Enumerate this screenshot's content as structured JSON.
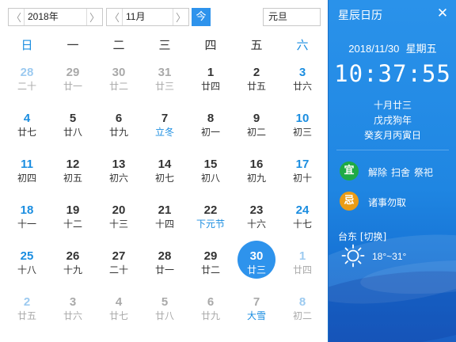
{
  "toolbar": {
    "year": "2018年",
    "month": "11月",
    "today_label": "今",
    "festival": "元旦",
    "prev_glyph": "〈",
    "next_glyph": "〉"
  },
  "weekdays": [
    "日",
    "一",
    "二",
    "三",
    "四",
    "五",
    "六"
  ],
  "days": [
    {
      "n": "28",
      "l": "二十",
      "other": true
    },
    {
      "n": "29",
      "l": "廿一",
      "other": true
    },
    {
      "n": "30",
      "l": "廿二",
      "other": true
    },
    {
      "n": "31",
      "l": "廿三",
      "other": true
    },
    {
      "n": "1",
      "l": "廿四"
    },
    {
      "n": "2",
      "l": "廿五"
    },
    {
      "n": "3",
      "l": "廿六"
    },
    {
      "n": "4",
      "l": "廿七"
    },
    {
      "n": "5",
      "l": "廿八"
    },
    {
      "n": "6",
      "l": "廿九"
    },
    {
      "n": "7",
      "l": "立冬",
      "term": true
    },
    {
      "n": "8",
      "l": "初一"
    },
    {
      "n": "9",
      "l": "初二"
    },
    {
      "n": "10",
      "l": "初三"
    },
    {
      "n": "11",
      "l": "初四"
    },
    {
      "n": "12",
      "l": "初五"
    },
    {
      "n": "13",
      "l": "初六"
    },
    {
      "n": "14",
      "l": "初七"
    },
    {
      "n": "15",
      "l": "初八"
    },
    {
      "n": "16",
      "l": "初九"
    },
    {
      "n": "17",
      "l": "初十"
    },
    {
      "n": "18",
      "l": "十一"
    },
    {
      "n": "19",
      "l": "十二"
    },
    {
      "n": "20",
      "l": "十三"
    },
    {
      "n": "21",
      "l": "十四"
    },
    {
      "n": "22",
      "l": "下元节",
      "term": true
    },
    {
      "n": "23",
      "l": "十六"
    },
    {
      "n": "24",
      "l": "十七"
    },
    {
      "n": "25",
      "l": "十八"
    },
    {
      "n": "26",
      "l": "十九"
    },
    {
      "n": "27",
      "l": "二十"
    },
    {
      "n": "28",
      "l": "廿一"
    },
    {
      "n": "29",
      "l": "廿二"
    },
    {
      "n": "30",
      "l": "廿三",
      "selected": true
    },
    {
      "n": "1",
      "l": "廿四",
      "other": true
    },
    {
      "n": "2",
      "l": "廿五",
      "other": true
    },
    {
      "n": "3",
      "l": "廿六",
      "other": true
    },
    {
      "n": "4",
      "l": "廿七",
      "other": true
    },
    {
      "n": "5",
      "l": "廿八",
      "other": true
    },
    {
      "n": "6",
      "l": "廿九",
      "other": true
    },
    {
      "n": "7",
      "l": "大雪",
      "other": true,
      "term": true
    },
    {
      "n": "8",
      "l": "初二",
      "other": true
    }
  ],
  "panel": {
    "title": "星辰日历",
    "close_glyph": "✕",
    "date": "2018/11/30",
    "weekday": "星期五",
    "time": "10:37:55",
    "lunar_line1": "十月廿三",
    "lunar_line2": "戊戌狗年",
    "lunar_line3": "癸亥月丙寅日",
    "yi_label": "宜",
    "yi_items": [
      "解除",
      "扫舍",
      "祭祀"
    ],
    "ji_label": "忌",
    "ji_items": [
      "诸事勿取"
    ],
    "location": "台东 [切换]",
    "temperature": "18°~31°",
    "weather_icon": "sun-icon"
  },
  "colors": {
    "accent": "#2e93ec",
    "weekend": "#1a8de0",
    "yi": "#1faa45",
    "ji": "#eb9c16"
  }
}
